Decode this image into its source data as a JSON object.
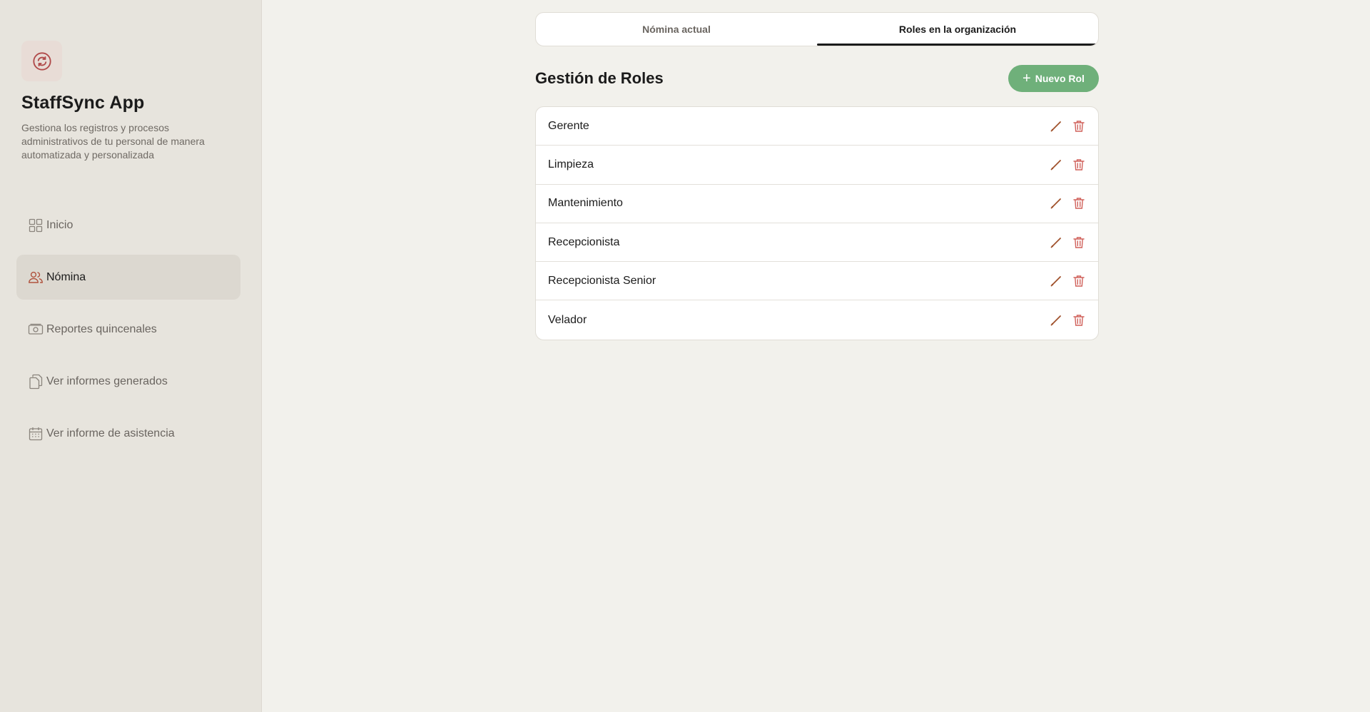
{
  "app": {
    "title": "StaffSync App",
    "description": "Gestiona los registros y procesos administrativos de tu personal de manera automatizada y personalizada",
    "logo_icon": "refresh-cycle-icon"
  },
  "sidebar": {
    "items": [
      {
        "label": "Inicio",
        "icon": "grid-icon",
        "active": false
      },
      {
        "label": "Nómina",
        "icon": "users-icon",
        "active": true
      },
      {
        "label": "Reportes quincenales",
        "icon": "money-icon",
        "active": false
      },
      {
        "label": "Ver informes generados",
        "icon": "documents-icon",
        "active": false
      },
      {
        "label": "Ver informe de asistencia",
        "icon": "calendar-icon",
        "active": false
      }
    ]
  },
  "tabs": [
    {
      "label": "Nómina actual",
      "active": false
    },
    {
      "label": "Roles en la organización",
      "active": true
    }
  ],
  "section": {
    "title": "Gestión de Roles",
    "new_button_label": "Nuevo Rol"
  },
  "roles": [
    {
      "name": "Gerente"
    },
    {
      "name": "Limpieza"
    },
    {
      "name": "Mantenimiento"
    },
    {
      "name": "Recepcionista"
    },
    {
      "name": "Recepcionista Senior"
    },
    {
      "name": "Velador"
    }
  ],
  "colors": {
    "accent_green": "#6fb07a",
    "edit_icon": "#a0522d",
    "delete_icon": "#d0605a",
    "logo_icon": "#b04a4a"
  }
}
